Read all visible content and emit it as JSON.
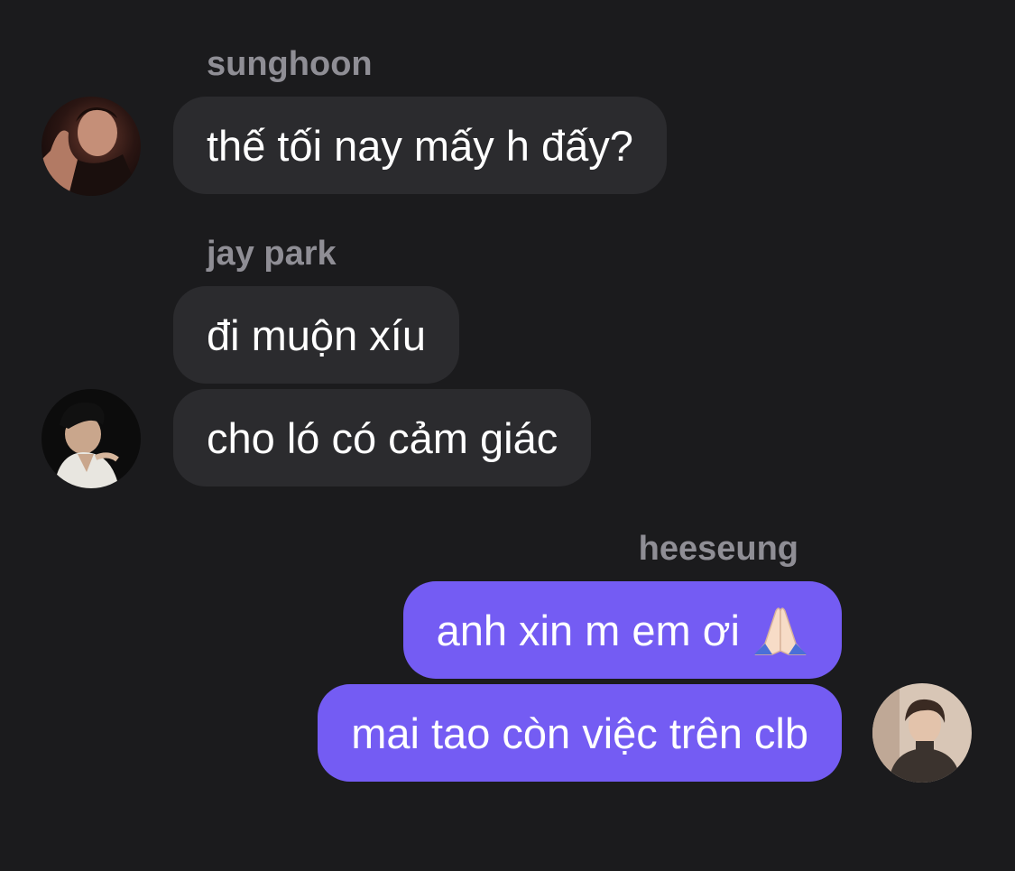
{
  "messages": [
    {
      "sender": "sunghoon",
      "text": "thế tối nay mấy h đấy?",
      "avatar": "sunghoon-avatar"
    },
    {
      "sender": "jay park",
      "text": "đi muộn xíu"
    },
    {
      "text": "cho ló có cảm giác",
      "avatar": "jay-park-avatar"
    },
    {
      "sender": "heeseung",
      "text": "anh xin m em ơi",
      "emoji": "folded-hands-icon"
    },
    {
      "text": "mai tao còn việc trên clb",
      "avatar": "heeseung-avatar"
    }
  ],
  "colors": {
    "background": "#1b1b1d",
    "incoming_bubble": "#2b2b2e",
    "outgoing_bubble": "#745cf3",
    "sender_name": "#8f8e95",
    "message_text": "#ffffff"
  }
}
